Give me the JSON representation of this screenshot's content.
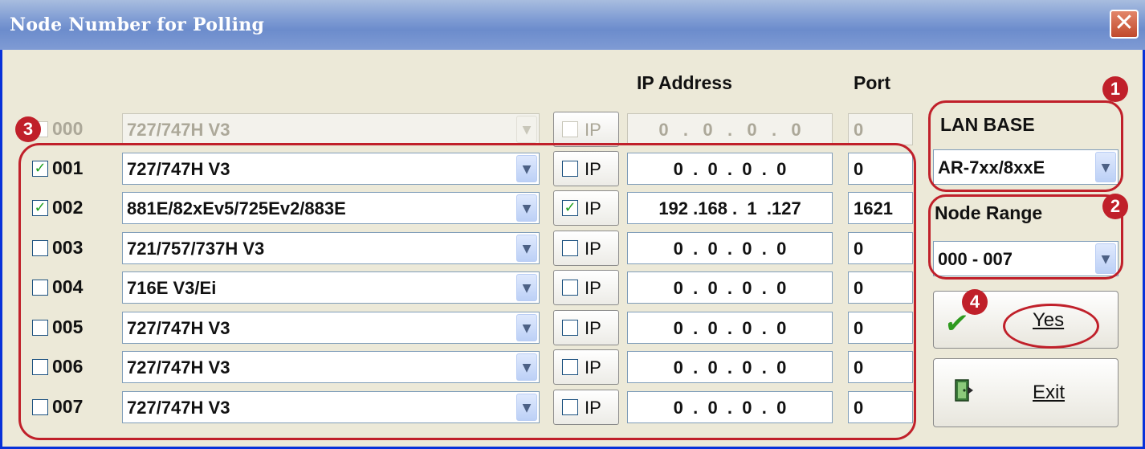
{
  "window": {
    "title": "Node Number for Polling",
    "close_glyph": "✕"
  },
  "headers": {
    "ip_address": "IP Address",
    "port": "Port"
  },
  "rows": [
    {
      "checked": false,
      "node": "000",
      "module": "727/747H V3",
      "ip_checked": false,
      "ip_label": "IP",
      "ip": "0   .   0   .   0   .   0",
      "port": "0",
      "enabled": false
    },
    {
      "checked": true,
      "node": "001",
      "module": "727/747H V3",
      "ip_checked": false,
      "ip_label": "IP",
      "ip": "0  .  0  .  0  .  0",
      "port": "0",
      "enabled": true
    },
    {
      "checked": true,
      "node": "002",
      "module": "881E/82xEv5/725Ev2/883E",
      "ip_checked": true,
      "ip_label": "IP",
      "ip": "192 .168 .  1  .127",
      "port": "1621",
      "enabled": true
    },
    {
      "checked": false,
      "node": "003",
      "module": "721/757/737H V3",
      "ip_checked": false,
      "ip_label": "IP",
      "ip": "0  .  0  .  0  .  0",
      "port": "0",
      "enabled": true
    },
    {
      "checked": false,
      "node": "004",
      "module": "716E V3/Ei",
      "ip_checked": false,
      "ip_label": "IP",
      "ip": "0  .  0  .  0  .  0",
      "port": "0",
      "enabled": true
    },
    {
      "checked": false,
      "node": "005",
      "module": "727/747H V3",
      "ip_checked": false,
      "ip_label": "IP",
      "ip": "0  .  0  .  0  .  0",
      "port": "0",
      "enabled": true
    },
    {
      "checked": false,
      "node": "006",
      "module": "727/747H V3",
      "ip_checked": false,
      "ip_label": "IP",
      "ip": "0  .  0  .  0  .  0",
      "port": "0",
      "enabled": true
    },
    {
      "checked": false,
      "node": "007",
      "module": "727/747H V3",
      "ip_checked": false,
      "ip_label": "IP",
      "ip": "0  .  0  .  0  .  0",
      "port": "0",
      "enabled": true
    }
  ],
  "side": {
    "lan_base_label": "LAN BASE",
    "lan_base_value": "AR-7xx/8xxE",
    "node_range_label": "Node Range",
    "node_range_value": "000 - 007",
    "yes_label": "Yes",
    "exit_label": "Exit"
  },
  "annotations": [
    "1",
    "2",
    "3",
    "4"
  ],
  "glyphs": {
    "check": "✔",
    "dropdown": "▼"
  },
  "colors": {
    "annotation": "#c0202a",
    "titlebar": "#7e9bd3",
    "window_bg": "#ece9d8",
    "check_green": "#21a121"
  }
}
